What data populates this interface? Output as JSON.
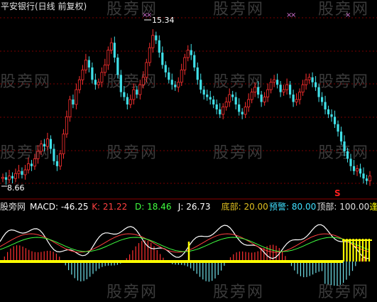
{
  "header": {
    "title": "平安银行(日线 前复权)"
  },
  "watermark": "股旁网",
  "price_labels": {
    "high": "15.34",
    "low": "8.66"
  },
  "indicator_bar": {
    "name": "股旁网",
    "items": [
      {
        "label": "MACD: -46.25",
        "color": "#ffffff"
      },
      {
        "label": "K: 21.22",
        "color": "#ff4040"
      },
      {
        "label": "D: 18.46",
        "color": "#40ff40"
      },
      {
        "label": "J: 26.73",
        "color": "#ffffff"
      },
      {
        "label": "底部: 20.00",
        "color": "#e0c020"
      },
      {
        "label": "预警: 80.00",
        "color": "#40e0ff"
      },
      {
        "label": "顶部: 100.00",
        "color": "#e0e0e0"
      },
      {
        "label": "逢低",
        "color": "#ffff00"
      }
    ]
  },
  "chart_data": [
    {
      "type": "candlestick",
      "title": "平安银行(日线 前复权)",
      "annotated_high": 15.34,
      "annotated_low": 8.66,
      "colors": {
        "up": "#ff3030",
        "down": "#40e0e8",
        "grid": "#8b0000"
      },
      "series": [
        {
          "name": "close",
          "values": [
            9.05,
            8.95,
            9.1,
            9.0,
            9.2,
            9.3,
            9.15,
            9.35,
            9.6,
            9.5,
            9.8,
            10.1,
            10.4,
            10.3,
            10.6,
            10.2,
            9.7,
            9.5,
            10.0,
            10.8,
            11.5,
            12.2,
            12.0,
            12.6,
            13.0,
            13.4,
            13.8,
            13.5,
            13.0,
            12.8,
            12.9,
            13.3,
            13.6,
            14.2,
            14.5,
            13.9,
            13.2,
            12.5,
            12.3,
            12.0,
            12.2,
            12.6,
            12.4,
            12.8,
            13.1,
            13.7,
            14.3,
            14.8,
            14.6,
            14.1,
            13.6,
            13.3,
            13.0,
            12.8,
            12.7,
            12.9,
            13.4,
            13.9,
            14.2,
            14.0,
            13.5,
            13.0,
            12.6,
            12.4,
            12.3,
            12.2,
            12.0,
            11.8,
            11.6,
            11.9,
            12.1,
            12.4,
            12.3,
            12.0,
            11.7,
            11.6,
            11.9,
            12.2,
            12.5,
            12.7,
            12.4,
            12.1,
            12.3,
            12.6,
            12.9,
            13.0,
            12.8,
            12.5,
            12.6,
            12.8,
            12.4,
            12.1,
            12.2,
            12.5,
            12.8,
            13.0,
            13.1,
            12.9,
            12.7,
            12.3,
            12.1,
            11.8,
            11.6,
            11.5,
            11.2,
            10.9,
            10.5,
            10.1,
            9.8,
            9.5,
            9.3,
            9.4,
            9.2,
            9.0,
            8.9,
            9.1
          ]
        }
      ]
    },
    {
      "type": "line",
      "title": "股旁网",
      "series": [
        {
          "name": "MACD",
          "last": -46.25
        },
        {
          "name": "K",
          "last": 21.22
        },
        {
          "name": "D",
          "last": 18.46
        },
        {
          "name": "J",
          "last": 26.73
        }
      ],
      "reference_levels": {
        "底部": 20.0,
        "预警": 80.0,
        "顶部": 100.0
      },
      "signal": "逢低"
    }
  ]
}
